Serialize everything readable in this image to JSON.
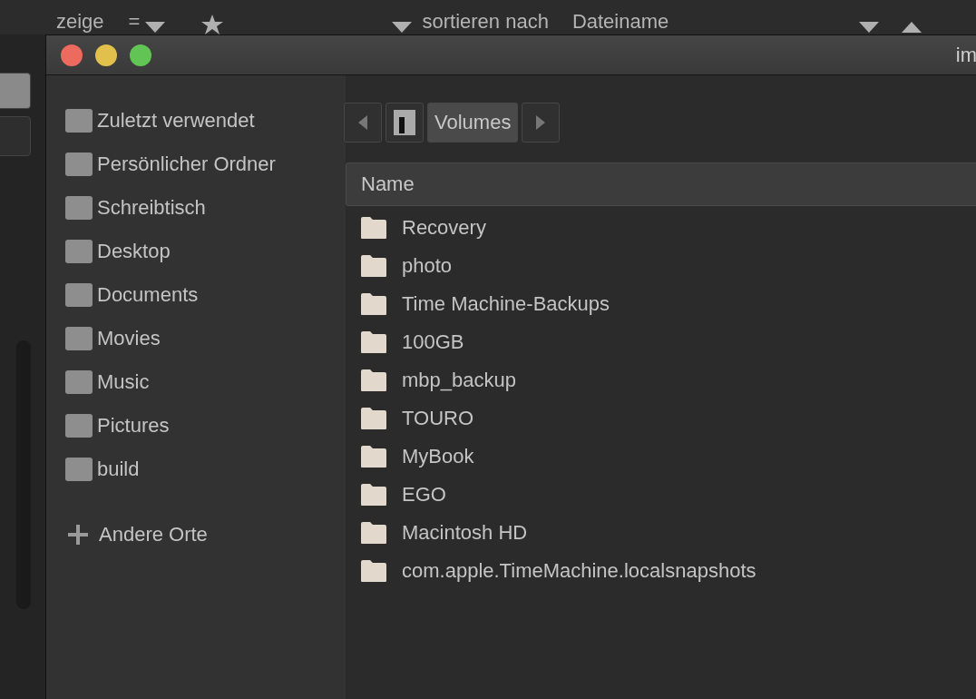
{
  "background_toolbar": {
    "show_label": "zeige",
    "filter_symbol": "=",
    "sort_label": "sortieren nach",
    "sort_value": "Dateiname"
  },
  "dialog": {
    "title": "im",
    "sidebar": {
      "places": [
        {
          "label": "Zuletzt verwendet"
        },
        {
          "label": "Persönlicher Ordner"
        },
        {
          "label": "Schreibtisch"
        },
        {
          "label": "Desktop"
        },
        {
          "label": "Documents"
        },
        {
          "label": "Movies"
        },
        {
          "label": "Music"
        },
        {
          "label": "Pictures"
        },
        {
          "label": "build"
        }
      ],
      "other_locations": "Andere Orte"
    },
    "path_bar": {
      "current": "Volumes"
    },
    "file_list": {
      "columns": [
        "Name"
      ],
      "rows": [
        {
          "name": "Recovery"
        },
        {
          "name": "photo"
        },
        {
          "name": "Time Machine-Backups"
        },
        {
          "name": "100GB"
        },
        {
          "name": "mbp_backup"
        },
        {
          "name": "TOURO"
        },
        {
          "name": "MyBook"
        },
        {
          "name": "EGO"
        },
        {
          "name": "Macintosh HD"
        },
        {
          "name": "com.apple.TimeMachine.localsnapshots"
        }
      ]
    }
  }
}
